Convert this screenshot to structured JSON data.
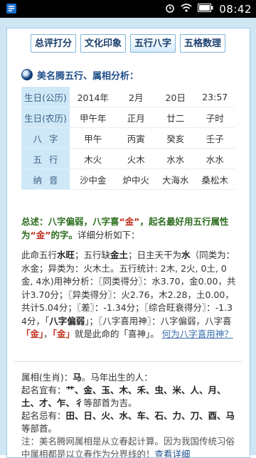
{
  "status_bar": {
    "time": "08:42",
    "icons": [
      "notification-icon",
      "alarm-icon",
      "wifi-icon",
      "battery-icon"
    ]
  },
  "tabs": [
    {
      "label": "总评打分"
    },
    {
      "label": "文化印象"
    },
    {
      "label": "五行八字"
    },
    {
      "label": "五格数理"
    }
  ],
  "section_title": "美名腾五行、属相分析：",
  "bazi_table": [
    {
      "label": "生日(公历)",
      "cells": [
        "2014年",
        "2月",
        "20日",
        "23:57"
      ]
    },
    {
      "label": "生日(农历)",
      "cells": [
        "甲午年",
        "正月",
        "廿二",
        "子时"
      ]
    },
    {
      "label": "八字",
      "cells": [
        "甲午",
        "丙寅",
        "癸亥",
        "壬子"
      ]
    },
    {
      "label": "五行",
      "cells": [
        "木火",
        "火木",
        "水水",
        "水水"
      ]
    },
    {
      "label": "纳音",
      "cells": [
        "沙中金",
        "炉中火",
        "大海水",
        "桑松木"
      ]
    }
  ],
  "summary": {
    "p1": "总述：",
    "p2": "八字偏弱，八字喜",
    "p3": "“金”",
    "p4": "，起名最好用五行属性为",
    "p5": "“金”",
    "p6": "的字。",
    "p7": "详细分析如下："
  },
  "analysis": {
    "t1": "此命五行",
    "t2": "水旺",
    "t3": "；五行缺",
    "t4": "金土",
    "t5": "；日主天干为",
    "t6": "水",
    "t7": "（同类为：水金；异类为：火木土。五行统计: 2木, 2火, 0土, 0金, 4水)用神分析：〖同类得分〗：水3.70，金0.00，共计3.70分；〖异类得分〗：火2.76，木2.28，土0.00，共计5.04分；〖差〗：-1.34分；〖综合旺衰得分〗：-1.34分，「",
    "t8": "八字偏弱",
    "t9": "」；〖八字喜用神〗：八字偏弱，八字喜",
    "t10": "「金」",
    "t11": "，",
    "t12": "「金」",
    "t13": "就是此命的「喜神」。",
    "link": "何为八字喜用神？"
  },
  "zodiac": {
    "l1a": "属相(生肖)：",
    "l1b": "马",
    "l1c": "。马年出生的人：",
    "l2a": "起名宜有：",
    "l2b": "艹、金、玉、木、禾、虫、米、人、月、土、才、乍、彳",
    "l2c": "等部首为吉。",
    "l3a": "起名忌有：",
    "l3b": "田、日、火、水、车、石、力、刀、酉、马",
    "l3c": "等部首。",
    "note": "注：美名腾网属相是从立春起计算。因为我国传统习俗中属相都是以立春作为分界线的！",
    "link": "查看详细"
  }
}
